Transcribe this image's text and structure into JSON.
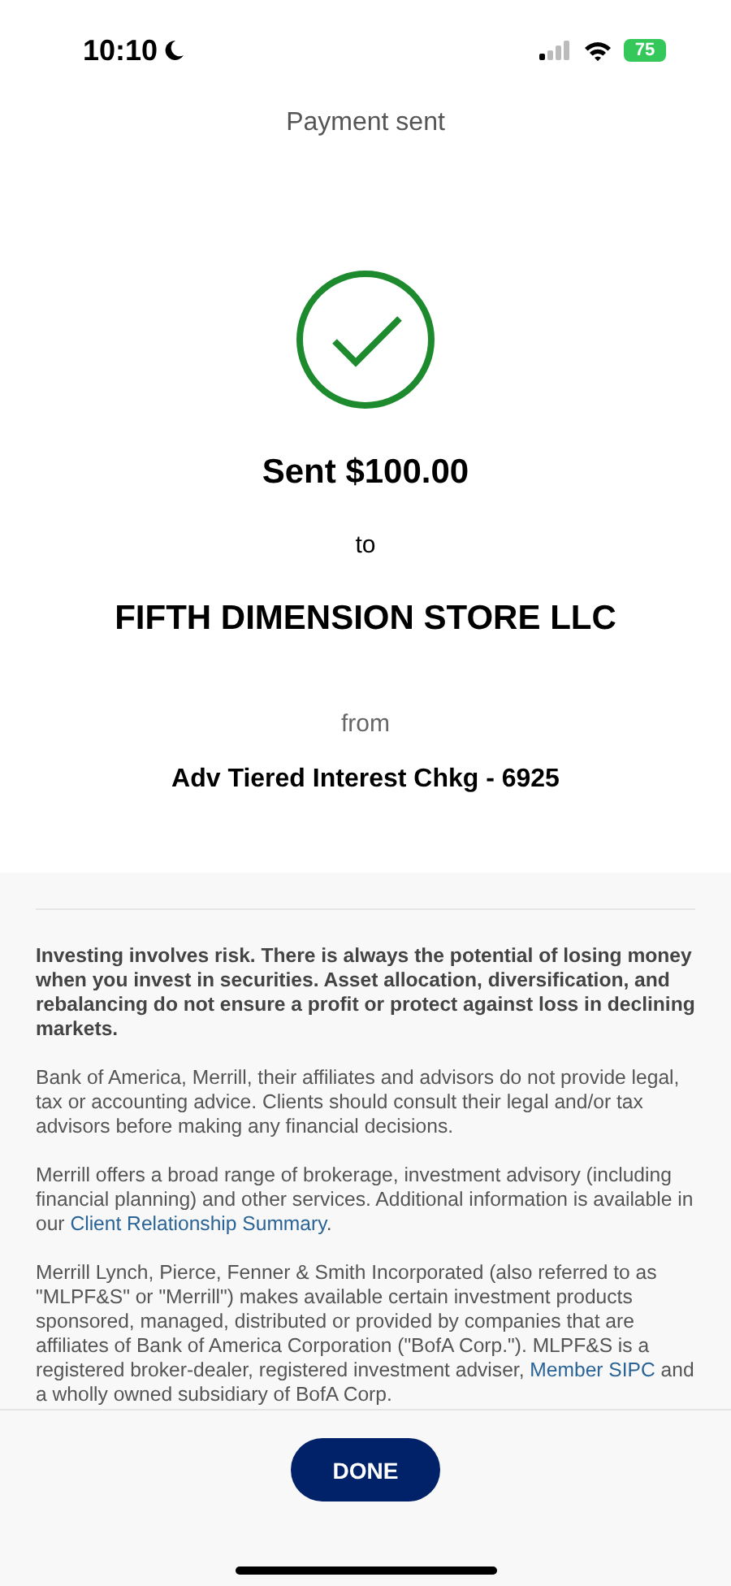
{
  "status_bar": {
    "time": "10:10",
    "battery": "75"
  },
  "header": {
    "title": "Payment sent"
  },
  "confirmation": {
    "amount": "Sent $100.00",
    "to_label": "to",
    "payee": "FIFTH DIMENSION STORE LLC",
    "from_label": "from",
    "account": "Adv Tiered Interest Chkg - 6925"
  },
  "disclosures": [
    {
      "kind": "bold",
      "parts": [
        {
          "kind": "text",
          "text": "Investing involves risk. There is always the potential of losing money when you invest in securities. Asset allocation, diversification, and rebalancing do not ensure a profit or protect against loss in declining markets."
        }
      ]
    },
    {
      "kind": "plain",
      "parts": [
        {
          "kind": "text",
          "text": "Bank of America, Merrill, their affiliates and advisors do not provide legal, tax or accounting advice. Clients should consult their legal and/or tax advisors before making any financial decisions."
        }
      ]
    },
    {
      "kind": "plain",
      "parts": [
        {
          "kind": "text",
          "text": "Merrill offers a broad range of brokerage, investment advisory (including financial planning) and other services. Additional information is available in our "
        },
        {
          "kind": "link",
          "text": "Client Relationship Summary"
        },
        {
          "kind": "text",
          "text": "."
        }
      ]
    },
    {
      "kind": "plain",
      "parts": [
        {
          "kind": "text",
          "text": "Merrill Lynch, Pierce, Fenner & Smith Incorporated (also referred to as \"MLPF&S\" or \"Merrill\") makes available certain investment products sponsored, managed, distributed or provided by companies that are affiliates of Bank of America Corporation (\"BofA Corp.\"). MLPF&S is a registered broker-dealer, registered investment adviser, "
        },
        {
          "kind": "link",
          "text": "Member SIPC"
        },
        {
          "kind": "text",
          "text": " and a wholly owned subsidiary of BofA Corp."
        }
      ]
    }
  ],
  "footer": {
    "button": "DONE"
  }
}
